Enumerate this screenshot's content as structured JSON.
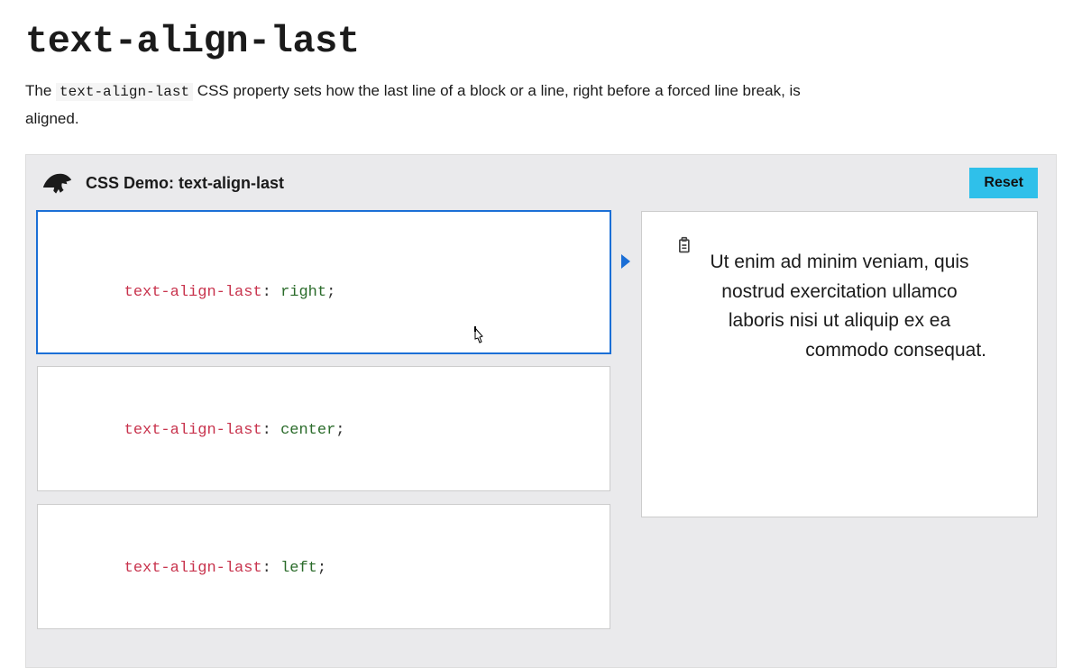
{
  "page": {
    "title": "text-align-last",
    "intro_pre": "The ",
    "intro_code": "text-align-last",
    "intro_post": " CSS property sets how the last line of a block or a line, right before a forced line break, is aligned."
  },
  "demo": {
    "title": "CSS Demo: text-align-last",
    "reset_label": "Reset",
    "options": [
      {
        "property": "text-align-last",
        "value": "right",
        "active": true
      },
      {
        "property": "text-align-last",
        "value": "center",
        "active": false
      },
      {
        "property": "text-align-last",
        "value": "left",
        "active": false
      }
    ],
    "output_text": "Ut enim ad minim veniam, quis nostrud exercitation ullamco laboris nisi ut aliquip ex ea commodo consequat.",
    "applied_text_align_last": "right"
  }
}
